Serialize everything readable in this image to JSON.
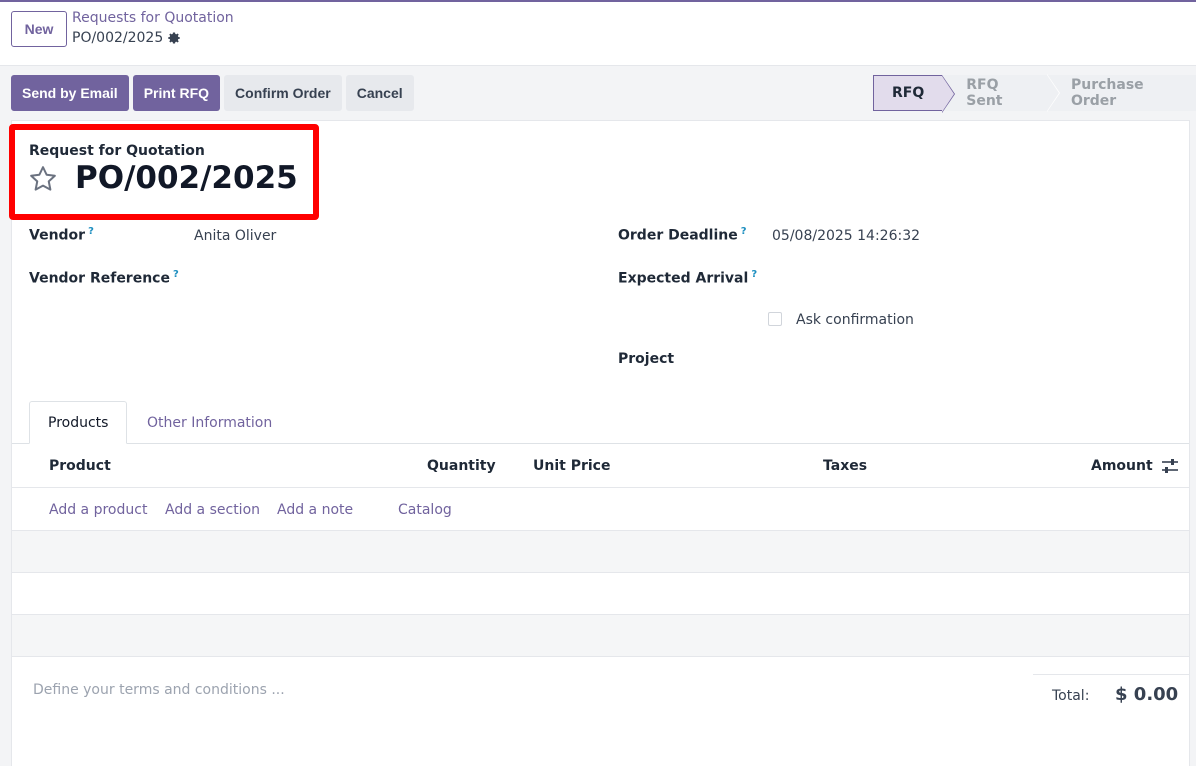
{
  "control_panel": {
    "new_label": "New",
    "breadcrumb_parent": "Requests for Quotation",
    "breadcrumb_current": "PO/002/2025"
  },
  "actions": {
    "send_by_email": "Send by Email",
    "print_rfq": "Print RFQ",
    "confirm_order": "Confirm Order",
    "cancel": "Cancel"
  },
  "status_stages": [
    "RFQ",
    "RFQ Sent",
    "Purchase Order"
  ],
  "status_active": "RFQ",
  "form": {
    "title_label": "Request for Quotation",
    "title_name": "PO/002/2025",
    "vendor_label": "Vendor",
    "vendor_value": "Anita Oliver",
    "vendor_ref_label": "Vendor Reference",
    "order_deadline_label": "Order Deadline",
    "order_deadline_value": "05/08/2025 14:26:32",
    "expected_arrival_label": "Expected Arrival",
    "ask_confirmation_label": "Ask confirmation",
    "project_label": "Project",
    "help_mark": "?"
  },
  "tabs": {
    "products": "Products",
    "other_info": "Other Information"
  },
  "table": {
    "columns": [
      "Product",
      "Quantity",
      "Unit Price",
      "Taxes",
      "Amount"
    ],
    "add_product": "Add a product",
    "add_section": "Add a section",
    "add_note": "Add a note",
    "catalog": "Catalog"
  },
  "footer": {
    "terms_placeholder": "Define your terms and conditions ...",
    "total_label": "Total:",
    "total_value": "$ 0.00"
  },
  "colors": {
    "accent": "#71639e",
    "highlight": "#ff0000",
    "help": "#1e8fc0"
  }
}
